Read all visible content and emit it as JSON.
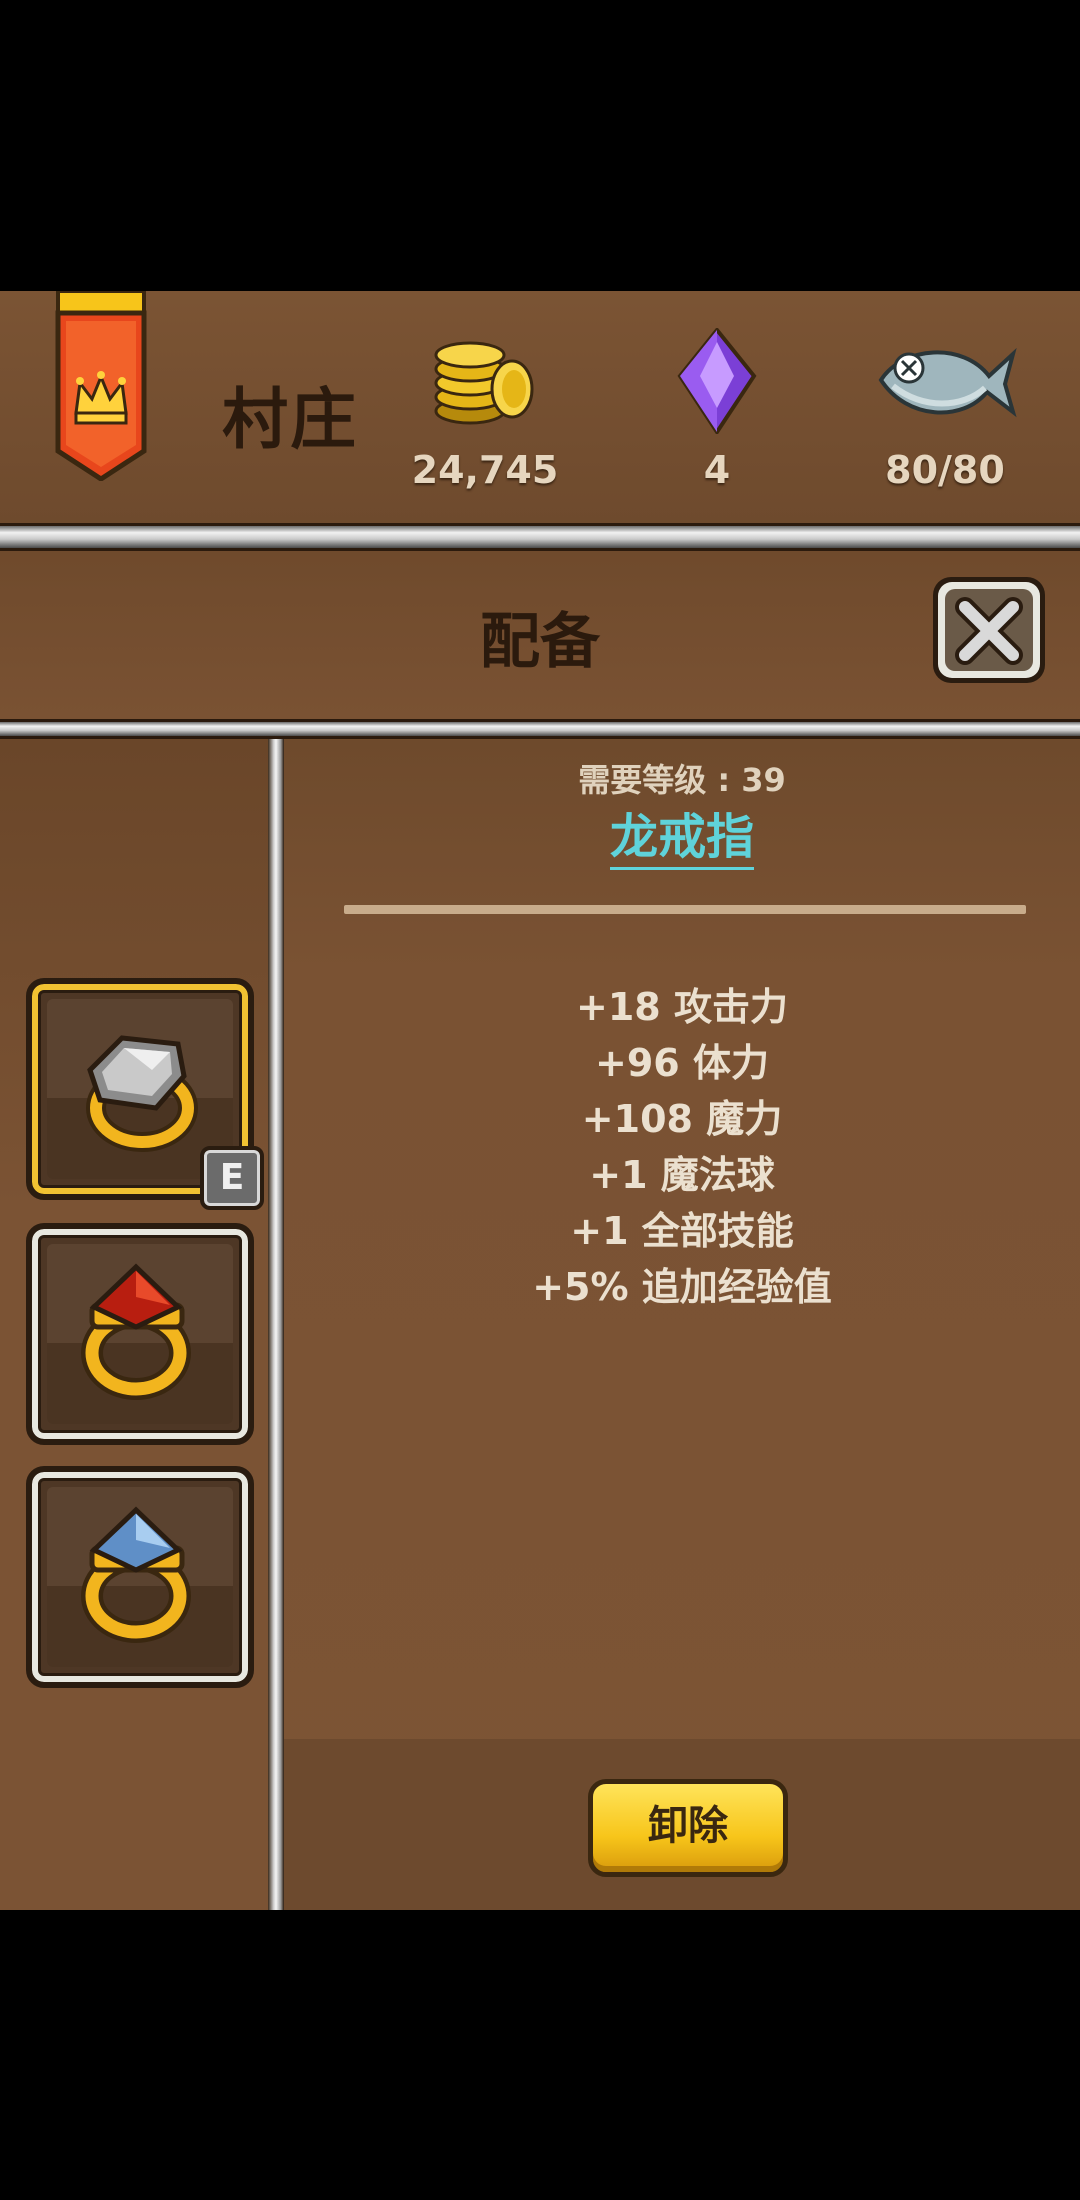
{
  "header": {
    "location": "村庄",
    "gold": "24,745",
    "gems": "4",
    "stamina": "80/80"
  },
  "panel": {
    "title": "配备"
  },
  "item": {
    "required_level": "需要等级 : 39",
    "name": "龙戒指",
    "stats": [
      "+18 攻击力",
      "+96 体力",
      "+108 魔力",
      "+1 魔法球",
      "+1 全部技能",
      "+5% 追加经验值"
    ]
  },
  "slots": [
    {
      "icon": "gray-gem-ring-icon",
      "equipped_badge": "E"
    },
    {
      "icon": "red-gem-ring-icon"
    },
    {
      "icon": "blue-gem-ring-icon"
    }
  ],
  "actions": {
    "unequip_label": "卸除"
  },
  "colors": {
    "background": "#7a5233",
    "item_name": "#5fd3da",
    "button": "#f7c51a"
  }
}
